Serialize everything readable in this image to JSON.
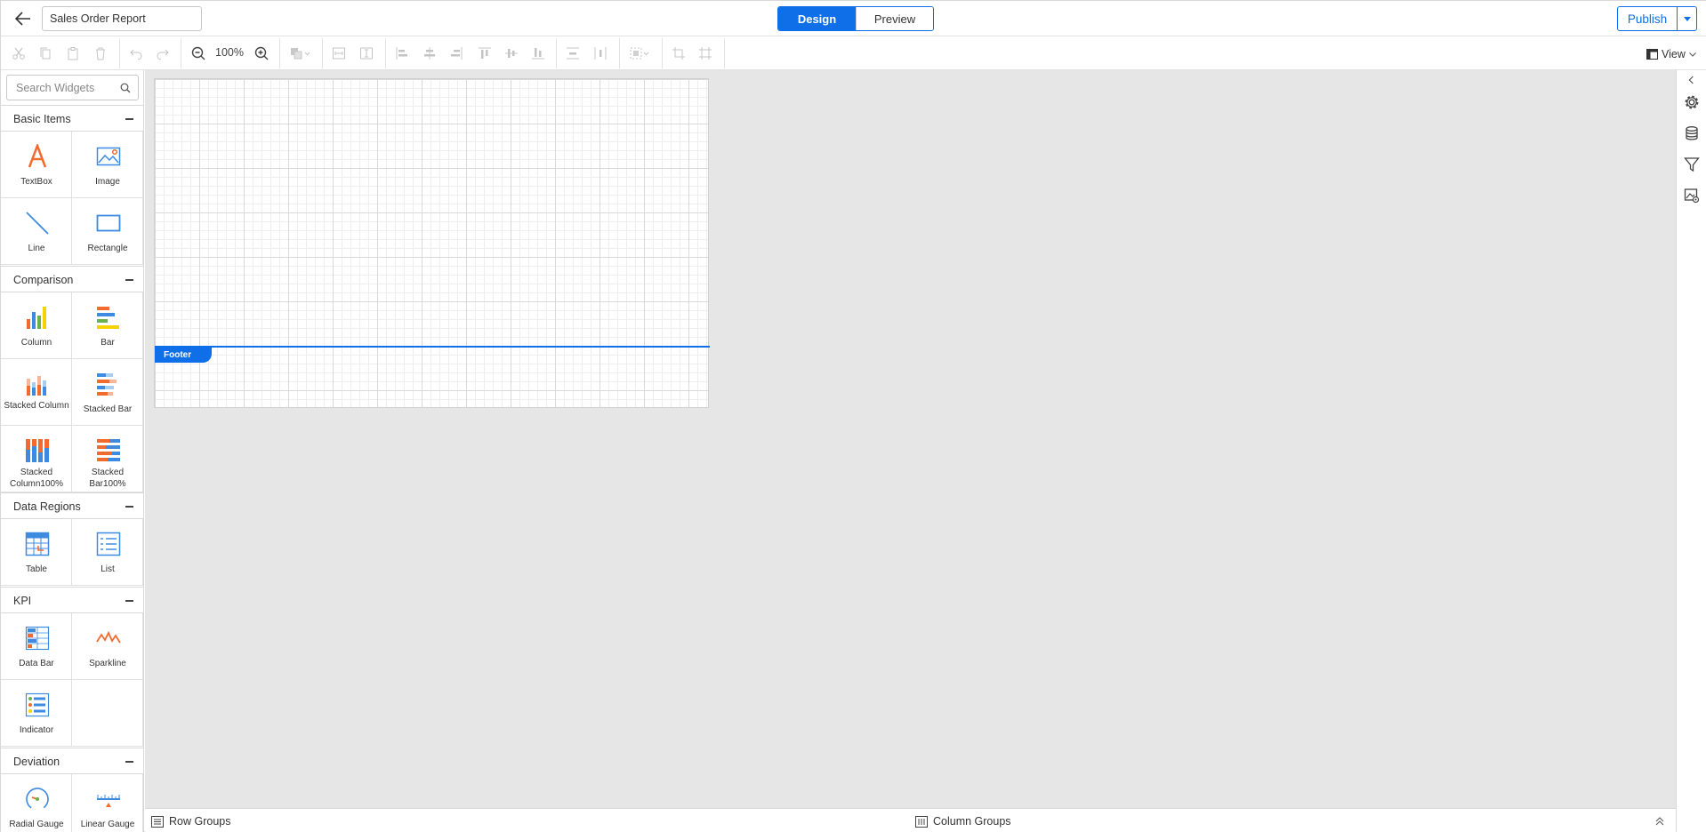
{
  "header": {
    "report_name": "Sales Order Report",
    "modes": [
      {
        "label": "Design",
        "active": true
      },
      {
        "label": "Preview",
        "active": false
      }
    ],
    "publish_label": "Publish"
  },
  "toolbar": {
    "zoom": "100%",
    "view_label": "View"
  },
  "left_panel": {
    "search_placeholder": "Search Widgets",
    "categories": [
      {
        "label": "Basic Items",
        "widgets": [
          "TextBox",
          "Image",
          "Line",
          "Rectangle"
        ]
      },
      {
        "label": "Comparison",
        "widgets": [
          "Column",
          "Bar",
          "Stacked Column",
          "Stacked Bar",
          "Stacked Column100%",
          "Stacked Bar100%"
        ]
      },
      {
        "label": "Data Regions",
        "widgets": [
          "Table",
          "List"
        ]
      },
      {
        "label": "KPI",
        "widgets": [
          "Data Bar",
          "Sparkline",
          "Indicator"
        ]
      },
      {
        "label": "Deviation",
        "widgets": [
          "Radial Gauge",
          "Linear Gauge"
        ]
      }
    ]
  },
  "canvas": {
    "footer_label": "Footer"
  },
  "bottom_bar": {
    "row_groups": "Row Groups",
    "column_groups": "Column Groups"
  },
  "colors": {
    "accent": "#0e6fe9",
    "canvas_bg": "#e6e6e6",
    "widget_orange": "#f26a2e",
    "widget_blue": "#3d8be0"
  }
}
